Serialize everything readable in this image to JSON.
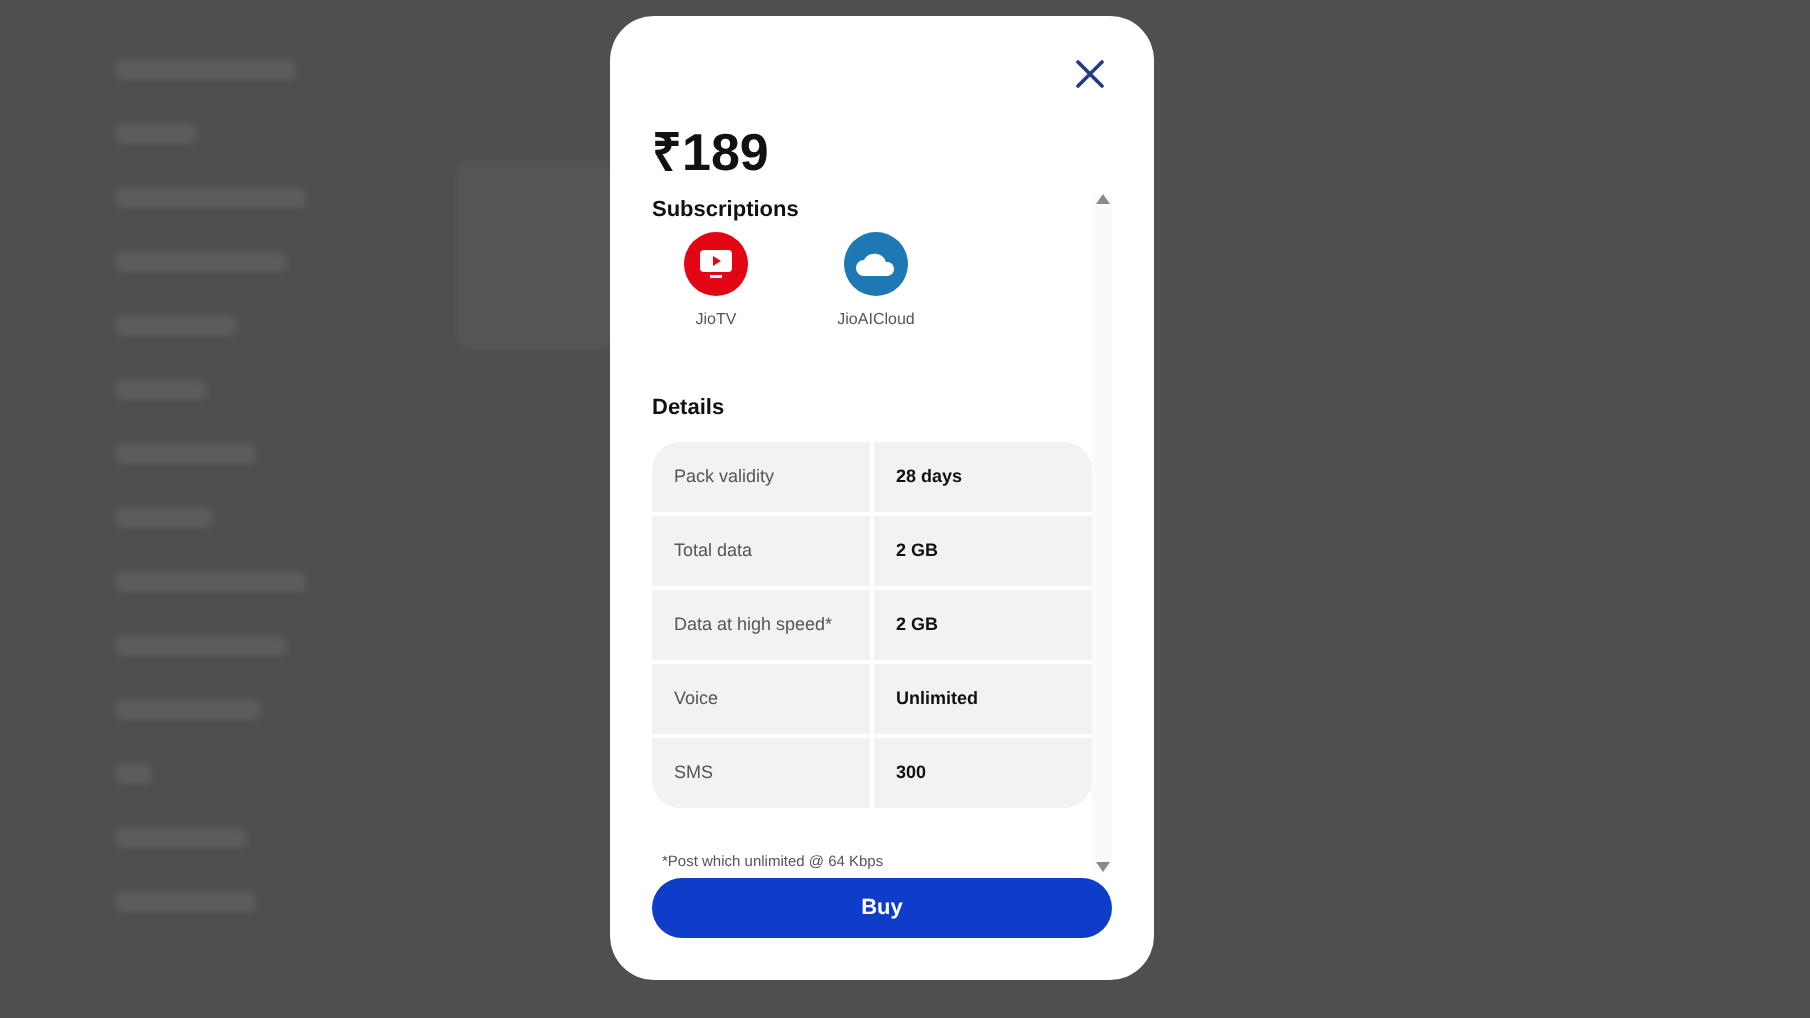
{
  "plan_modal": {
    "price": "₹189",
    "subscriptions_title": "Subscriptions",
    "subscriptions": [
      {
        "name": "JioTV",
        "kind": "tv",
        "color": "#e30513"
      },
      {
        "name": "JioAICloud",
        "kind": "cloud",
        "color": "#1d78b4"
      }
    ],
    "details_title": "Details",
    "details": [
      {
        "label": "Pack validity",
        "value": "28 days"
      },
      {
        "label": "Total data",
        "value": "2 GB"
      },
      {
        "label": "Data at high speed*",
        "value": "2 GB"
      },
      {
        "label": "Voice",
        "value": "Unlimited"
      },
      {
        "label": "SMS",
        "value": "300"
      }
    ],
    "footnote": "*Post which unlimited @ 64 Kbps",
    "buy_button": "Buy"
  }
}
